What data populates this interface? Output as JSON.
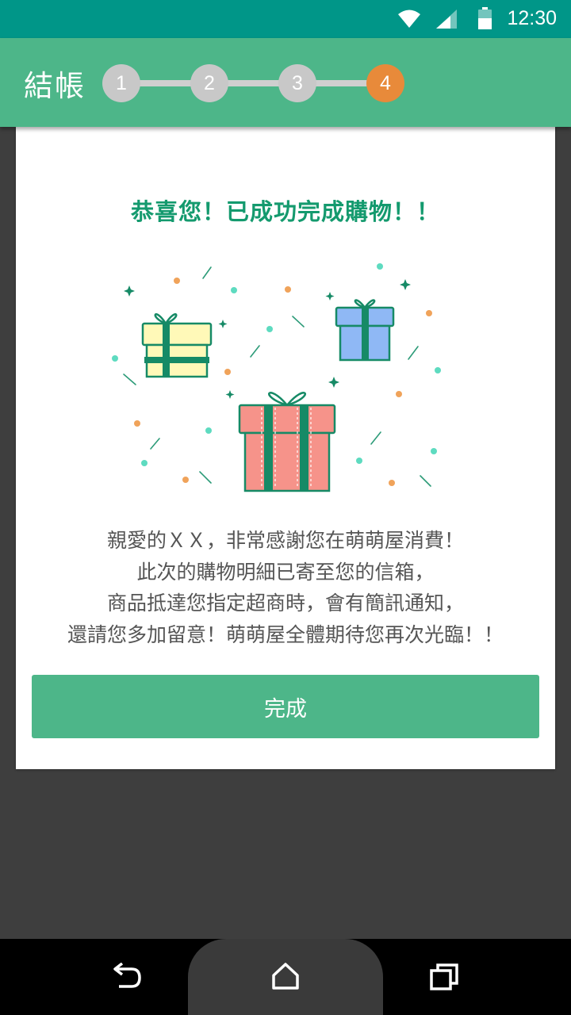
{
  "status_bar": {
    "time": "12:30",
    "icons": [
      "wifi-icon",
      "cell-signal-icon",
      "battery-icon"
    ]
  },
  "app_bar": {
    "title": "結帳",
    "steps": [
      {
        "number": "1",
        "state": "inactive"
      },
      {
        "number": "2",
        "state": "inactive"
      },
      {
        "number": "3",
        "state": "inactive"
      },
      {
        "number": "4",
        "state": "active"
      }
    ],
    "active_step": 4
  },
  "card": {
    "success_title": "恭喜您！已成功完成購物！！",
    "illustration_icons": [
      "gift-box-icon",
      "gift-box-icon",
      "gift-box-icon",
      "confetti"
    ],
    "message_lines": [
      "親愛的ＸＸ，非常感謝您在萌萌屋消費！",
      "此次的購物明細已寄至您的信箱，",
      "商品抵達您指定超商時，會有簡訊通知，",
      "還請您多加留意！萌萌屋全體期待您再次光臨！！"
    ],
    "done_label": "完成"
  },
  "nav_bar": {
    "icons": [
      "back-icon",
      "home-icon",
      "recent-apps-icon"
    ]
  },
  "colors": {
    "status_bar": "#009688",
    "app_bar": "#4db689",
    "active_step": "#e88a3a",
    "inactive_step": "#c8c8c8",
    "title_text": "#149a6e",
    "button": "#4db689",
    "background": "#3e3e3e"
  }
}
